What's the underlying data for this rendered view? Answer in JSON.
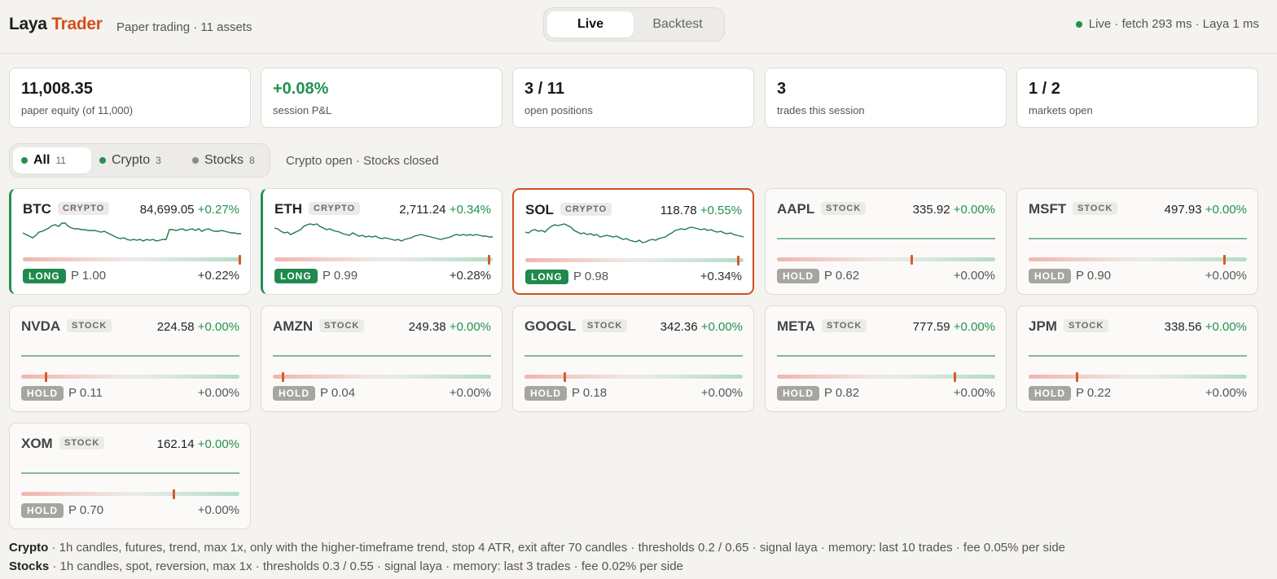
{
  "header": {
    "brand_part1": "Laya",
    "brand_part2": "Trader",
    "subtitle": "Paper trading · 11 assets",
    "modes": [
      "Live",
      "Backtest"
    ],
    "active_mode": "Live",
    "status": "Live · fetch 293 ms · Laya 1 ms"
  },
  "stats": [
    {
      "value": "11,008.35",
      "label": "paper equity (of 11,000)"
    },
    {
      "value": "+0.08%",
      "label": "session P&L"
    },
    {
      "value": "3 / 11",
      "label": "open positions"
    },
    {
      "value": "3",
      "label": "trades this session"
    },
    {
      "value": "1 / 2",
      "label": "markets open"
    }
  ],
  "filters": [
    {
      "label": "All",
      "count": "11"
    },
    {
      "label": "Crypto",
      "count": "3"
    },
    {
      "label": "Stocks",
      "count": "8"
    }
  ],
  "market_note": "Crypto open · Stocks closed",
  "cards": [
    {
      "symbol": "BTC",
      "type": "CRYPTO",
      "price": "84,699.05",
      "change": "+0.27%",
      "action": "LONG",
      "prob": "P 1.00",
      "pnl": "+0.22%",
      "prob_value": 1.0
    },
    {
      "symbol": "ETH",
      "type": "CRYPTO",
      "price": "2,711.24",
      "change": "+0.34%",
      "action": "LONG",
      "prob": "P 0.99",
      "pnl": "+0.28%",
      "prob_value": 0.99
    },
    {
      "symbol": "SOL",
      "type": "CRYPTO",
      "price": "118.78",
      "change": "+0.55%",
      "action": "LONG",
      "prob": "P 0.98",
      "pnl": "+0.34%",
      "prob_value": 0.98
    },
    {
      "symbol": "AAPL",
      "type": "STOCK",
      "price": "335.92",
      "change": "+0.00%",
      "action": "HOLD",
      "prob": "P 0.62",
      "pnl": "+0.00%",
      "prob_value": 0.62
    },
    {
      "symbol": "MSFT",
      "type": "STOCK",
      "price": "497.93",
      "change": "+0.00%",
      "action": "HOLD",
      "prob": "P 0.90",
      "pnl": "+0.00%",
      "prob_value": 0.9
    },
    {
      "symbol": "NVDA",
      "type": "STOCK",
      "price": "224.58",
      "change": "+0.00%",
      "action": "HOLD",
      "prob": "P 0.11",
      "pnl": "+0.00%",
      "prob_value": 0.11
    },
    {
      "symbol": "AMZN",
      "type": "STOCK",
      "price": "249.38",
      "change": "+0.00%",
      "action": "HOLD",
      "prob": "P 0.04",
      "pnl": "+0.00%",
      "prob_value": 0.04
    },
    {
      "symbol": "GOOGL",
      "type": "STOCK",
      "price": "342.36",
      "change": "+0.00%",
      "action": "HOLD",
      "prob": "P 0.18",
      "pnl": "+0.00%",
      "prob_value": 0.18
    },
    {
      "symbol": "META",
      "type": "STOCK",
      "price": "777.59",
      "change": "+0.00%",
      "action": "HOLD",
      "prob": "P 0.82",
      "pnl": "+0.00%",
      "prob_value": 0.82
    },
    {
      "symbol": "JPM",
      "type": "STOCK",
      "price": "338.56",
      "change": "+0.00%",
      "action": "HOLD",
      "prob": "P 0.22",
      "pnl": "+0.00%",
      "prob_value": 0.22
    },
    {
      "symbol": "XOM",
      "type": "STOCK",
      "price": "162.14",
      "change": "+0.00%",
      "action": "HOLD",
      "prob": "P 0.70",
      "pnl": "+0.00%",
      "prob_value": 0.7
    }
  ],
  "footer": {
    "crypto_label": "Crypto",
    "crypto_text": " · 1h candles, futures, trend, max 1x, only with the higher-timeframe trend, stop 4 ATR, exit after 70 candles · thresholds 0.2 / 0.65 · signal laya · memory: last 10 trades · fee 0.05% per side",
    "stocks_label": "Stocks",
    "stocks_text": " · 1h candles, spot, reversion, max 1x · thresholds 0.3 / 0.55 · signal laya · memory: last 3 trades · fee 0.02% per side"
  },
  "colors": {
    "accent": "#d44e1e",
    "positive": "#239150",
    "long_badge": "#1f8a4c",
    "hold_badge": "#a6a5a1",
    "background": "#f5f3ef"
  }
}
